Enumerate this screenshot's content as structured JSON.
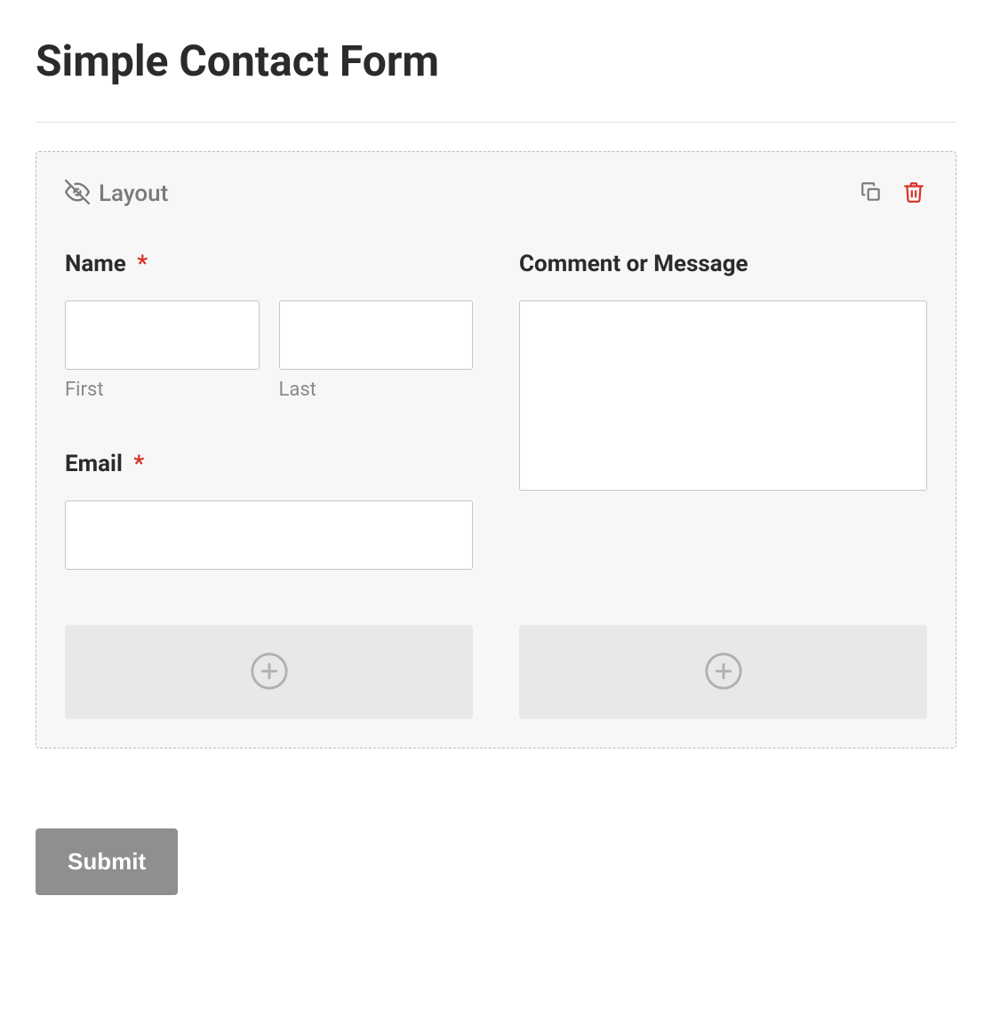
{
  "title": "Simple Contact Form",
  "layout": {
    "label": "Layout"
  },
  "fields": {
    "name": {
      "label": "Name",
      "required_marker": "*",
      "first_sublabel": "First",
      "last_sublabel": "Last",
      "first_value": "",
      "last_value": ""
    },
    "email": {
      "label": "Email",
      "required_marker": "*",
      "value": ""
    },
    "comment": {
      "label": "Comment or Message",
      "value": ""
    }
  },
  "submit": {
    "label": "Submit"
  },
  "icons": {
    "visibility": "visibility-off-icon",
    "duplicate": "duplicate-icon",
    "delete": "trash-icon",
    "add": "plus-circle-icon"
  },
  "colors": {
    "danger": "#d93025",
    "muted": "#8a8a8a",
    "text": "#2b2b2b",
    "bg_panel": "#f7f7f7"
  }
}
